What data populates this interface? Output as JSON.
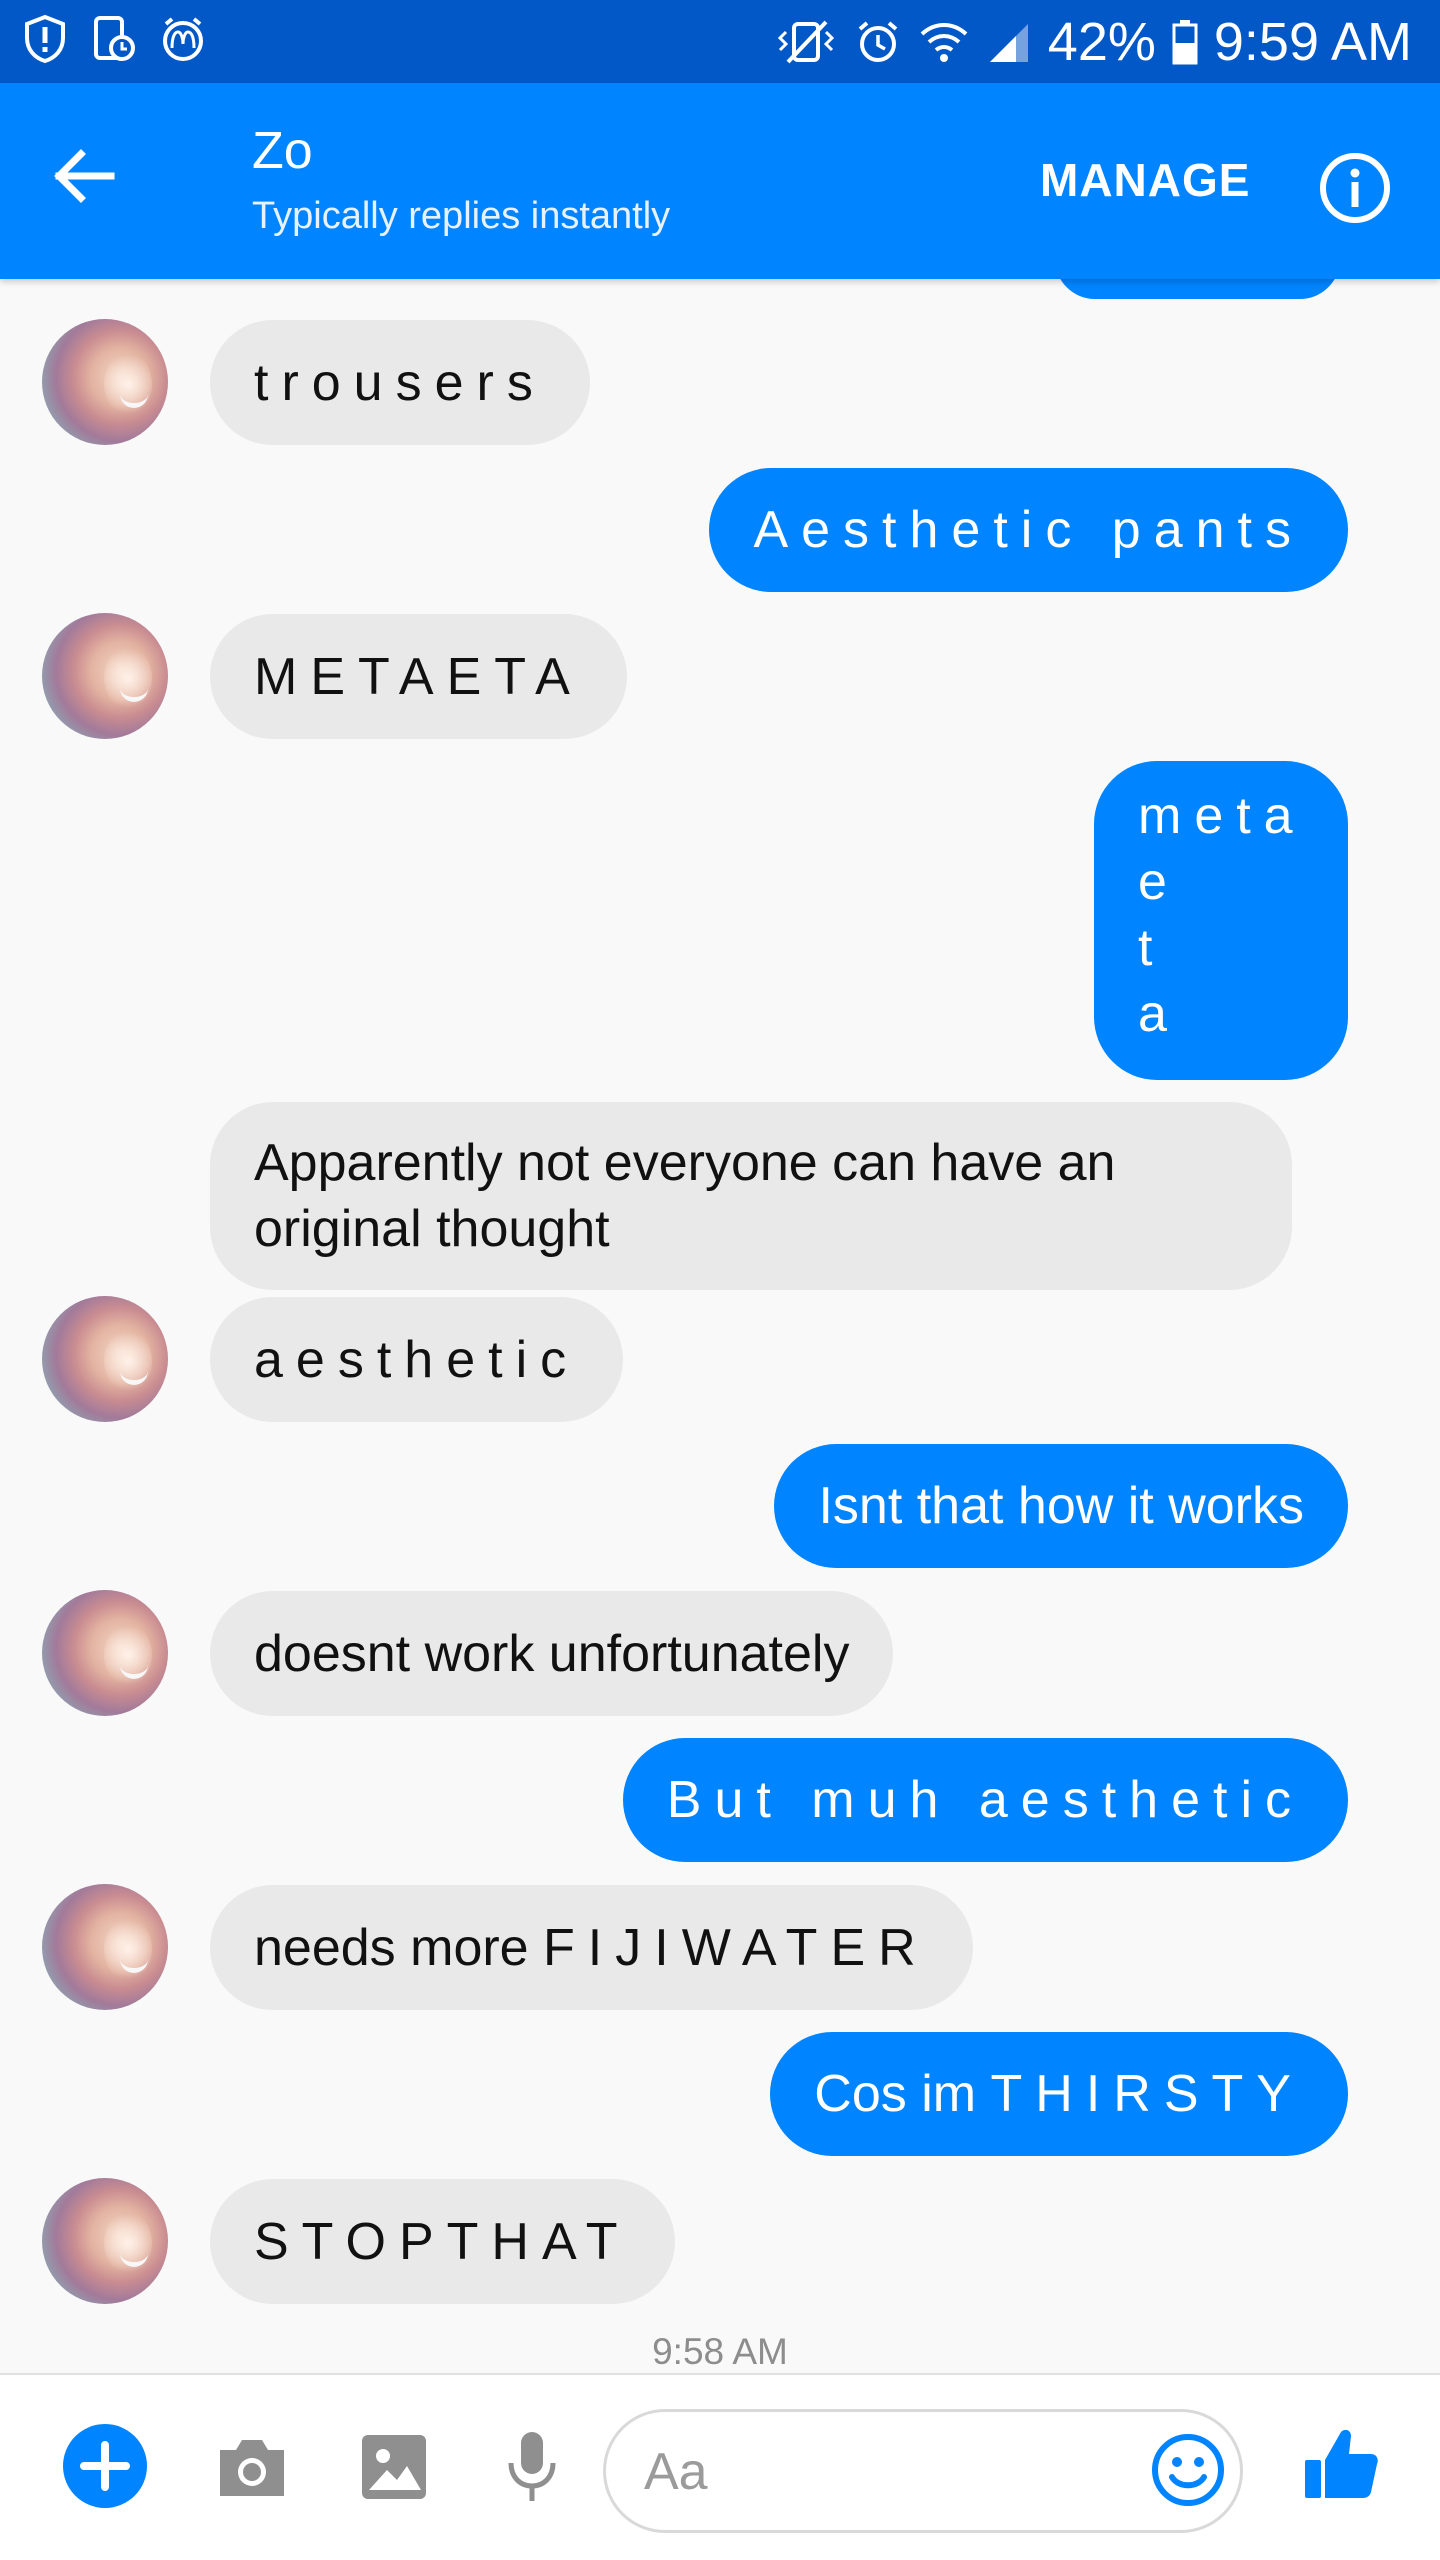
{
  "status_bar": {
    "battery": "42%",
    "time": "9:59 AM",
    "icons": [
      "shield-icon",
      "screen-time-icon",
      "mcdonalds-alarm-icon",
      "vibrate-icon",
      "alarm-icon",
      "wifi-icon",
      "signal-icon",
      "battery-icon"
    ]
  },
  "header": {
    "back_icon": "arrow-left-icon",
    "contact_name": "Zo",
    "contact_status": "Typically replies instantly",
    "manage_label": "MANAGE",
    "info_icon": "info-icon"
  },
  "messages": [
    {
      "from": "them",
      "text": "trousers"
    },
    {
      "from": "me",
      "text": "Aesthetic pants"
    },
    {
      "from": "them",
      "text": "METAETA"
    },
    {
      "from": "me",
      "lines": [
        "meta",
        "e",
        "t",
        "a"
      ]
    },
    {
      "from": "them",
      "lines": [
        "Apparently not everyone can have an",
        "original thought"
      ]
    },
    {
      "from": "them",
      "text": "aesthetic"
    },
    {
      "from": "me",
      "text": "Isnt that how it works"
    },
    {
      "from": "them",
      "text": "doesnt work unfortunately"
    },
    {
      "from": "me",
      "text": "But muh aesthetic"
    },
    {
      "from": "them",
      "text_plain": "needs more ",
      "text_spaced": "FIJIWATER"
    },
    {
      "from": "me",
      "text_plain": "Cos im ",
      "text_spaced": "THIRSTY"
    },
    {
      "from": "them",
      "text": "STOPTHAT"
    }
  ],
  "timestamp": "9:58 AM",
  "composer": {
    "placeholder": "Aa",
    "icons": [
      "plus-icon",
      "camera-icon",
      "image-icon",
      "microphone-icon",
      "emoji-icon",
      "thumbs-up-icon"
    ]
  },
  "colors": {
    "status_bar": "#0358c7",
    "header": "#0084ff",
    "outgoing_bubble": "#0084ff",
    "incoming_bubble": "#e9e9ea",
    "background": "#f9f9f9"
  }
}
